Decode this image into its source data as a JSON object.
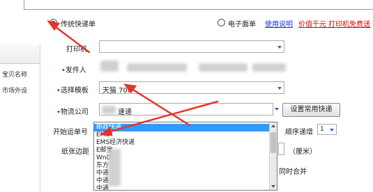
{
  "shipping_type": {
    "traditional_label": "传统快递单",
    "electronic_label": "电子面单",
    "usage_link": "使用说明",
    "promo_link": "价值千元 打印机免费送"
  },
  "form": {
    "printer_label": "打印机",
    "sender_label": "发件人",
    "template_label": "选择模板",
    "template_value": "天猫 700",
    "carrier_label": "物流公司",
    "carrier_value": "速递",
    "set_common_button": "设置常用快递",
    "start_number_label": "开始运单号",
    "sequence_label": "顺序递增",
    "sequence_value": "1",
    "margin_label": "纸张边距",
    "margin_unit": "（厘米）",
    "merge_label": "同时合并"
  },
  "left_list": {
    "rows": [
      "宝贝名称",
      "市场外设"
    ]
  },
  "carrier_dropdown": {
    "items": [
      {
        "label": "邮政快递",
        "selected": true
      },
      {
        "label": "EMS",
        "selected": false
      },
      {
        "label": "EMS经济快递",
        "selected": false
      },
      {
        "label": "E邮宝",
        "selected": false
      },
      {
        "label": "WnD",
        "selected": false
      },
      {
        "label": "东方",
        "selected": false
      },
      {
        "label": "中通",
        "selected": false
      },
      {
        "label": "中通",
        "selected": false
      },
      {
        "label": "中通",
        "selected": false
      }
    ]
  },
  "colors": {
    "required_star": "#e00000",
    "link_blue": "#1a33cc",
    "link_red": "#e00000",
    "selection": "#3399ff",
    "arrow": "#e5332a"
  }
}
